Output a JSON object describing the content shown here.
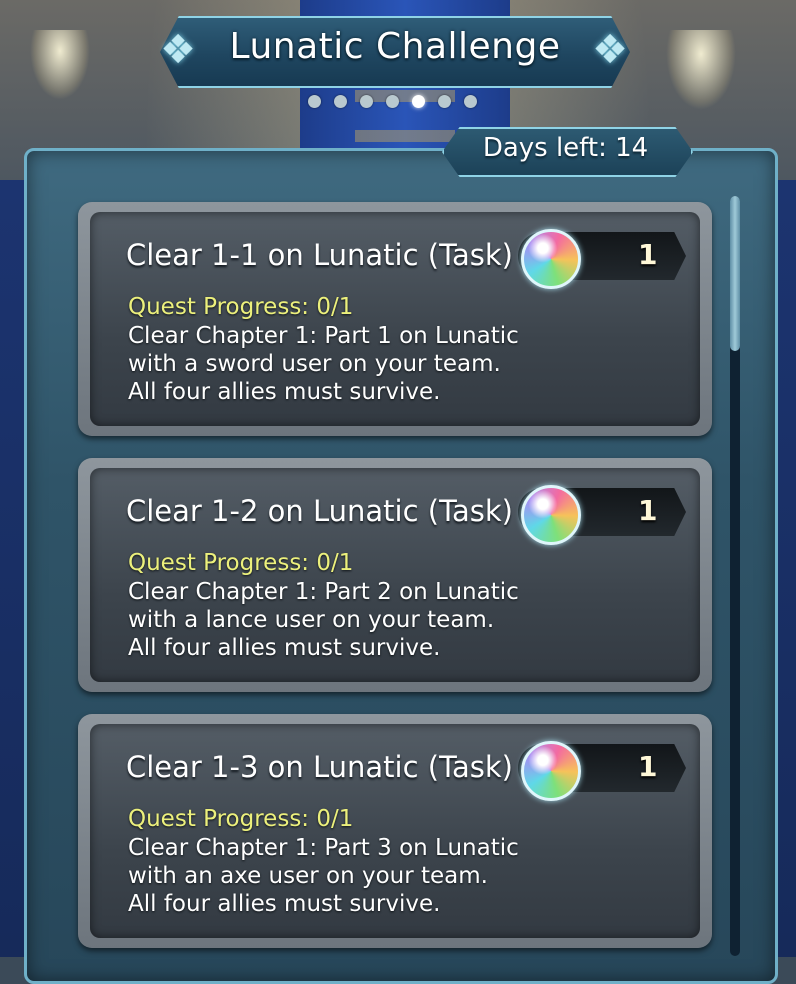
{
  "header": {
    "title": "Lunatic Challenge",
    "page_dots": {
      "count": 7,
      "active": 5
    },
    "days_left": "Days left: 14"
  },
  "icons": {
    "title_left": "ornament-icon",
    "title_right": "ornament-icon",
    "reward": "orb-icon"
  },
  "colors": {
    "panel_border": "#6fb0c8",
    "progress_text": "#ecf07c",
    "title_glow": "#8fd3e6"
  },
  "quests": [
    {
      "title": "Clear 1-1 on Lunatic (Task)",
      "reward_count": "1",
      "progress": "Quest Progress: 0/1",
      "description": [
        "Clear Chapter 1: Part 1 on Lunatic",
        "with a sword user on your team.",
        "All four allies must survive."
      ]
    },
    {
      "title": "Clear 1-2 on Lunatic (Task)",
      "reward_count": "1",
      "progress": "Quest Progress: 0/1",
      "description": [
        "Clear Chapter 1: Part 2 on Lunatic",
        "with a lance user on your team.",
        "All four allies must survive."
      ]
    },
    {
      "title": "Clear 1-3 on Lunatic (Task)",
      "reward_count": "1",
      "progress": "Quest Progress: 0/1",
      "description": [
        "Clear Chapter 1: Part 3 on Lunatic",
        "with an axe user on your team.",
        "All four allies must survive."
      ]
    }
  ]
}
